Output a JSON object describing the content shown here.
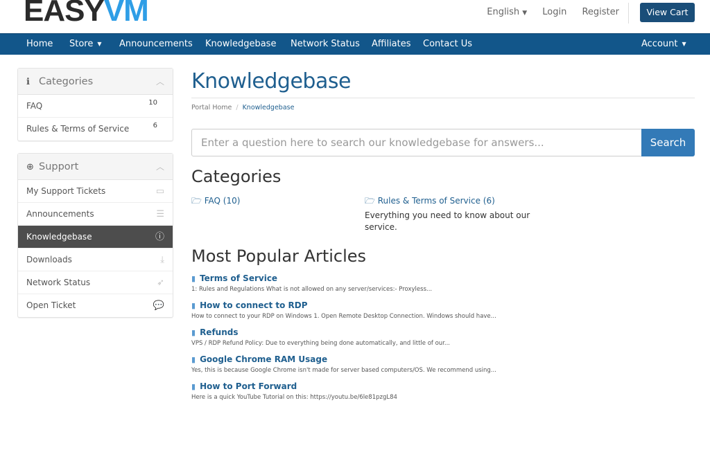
{
  "header": {
    "logo_part1": "EASY",
    "logo_part2": "VM",
    "language": "English",
    "login": "Login",
    "register": "Register",
    "view_cart": "View Cart"
  },
  "nav": {
    "home": "Home",
    "store": "Store",
    "announcements": "Announcements",
    "knowledgebase": "Knowledgebase",
    "network_status": "Network Status",
    "affiliates": "Affiliates",
    "contact_us": "Contact Us",
    "account": "Account"
  },
  "sidebar": {
    "categories_panel": {
      "title": "Categories",
      "items": [
        {
          "label": "FAQ",
          "count": "10"
        },
        {
          "label": "Rules & Terms of Service",
          "count": "6"
        }
      ]
    },
    "support_panel": {
      "title": "Support",
      "items": [
        {
          "label": "My Support Tickets",
          "icon": "ticket-icon"
        },
        {
          "label": "Announcements",
          "icon": "list-icon"
        },
        {
          "label": "Knowledgebase",
          "icon": "info-icon",
          "active": true
        },
        {
          "label": "Downloads",
          "icon": "download-icon"
        },
        {
          "label": "Network Status",
          "icon": "rocket-icon"
        },
        {
          "label": "Open Ticket",
          "icon": "comments-icon"
        }
      ]
    }
  },
  "main": {
    "title": "Knowledgebase",
    "breadcrumb": {
      "home": "Portal Home",
      "current": "Knowledgebase"
    },
    "search": {
      "placeholder": "Enter a question here to search our knowledgebase for answers...",
      "button": "Search"
    },
    "categories_heading": "Categories",
    "categories": [
      {
        "name": "FAQ (10)",
        "description": ""
      },
      {
        "name": "Rules & Terms of Service (6)",
        "description": "Everything you need to know about our service."
      }
    ],
    "popular_heading": "Most Popular Articles",
    "articles": [
      {
        "title": "Terms of Service",
        "excerpt": "1: Rules and Regulations What is not allowed on any server/services:- Proxyless..."
      },
      {
        "title": "How to connect to RDP",
        "excerpt": "How to connect to your RDP on Windows 1. Open Remote Desktop Connection. Windows should have..."
      },
      {
        "title": "Refunds",
        "excerpt": "VPS / RDP Refund Policy: Due to everything being done automatically, and little of our..."
      },
      {
        "title": "Google Chrome RAM Usage",
        "excerpt": "Yes, this is because Google Chrome isn't made for server based computers/OS. We recommend using..."
      },
      {
        "title": "How to Port Forward",
        "excerpt": "Here is a quick YouTube Tutorial on this: https://youtu.be/6le81pzgL84"
      }
    ]
  },
  "colors": {
    "navbar": "#12568a",
    "view_cart": "#1a4e79",
    "primary_link": "#1f5f8f",
    "search_button": "#337ab7",
    "active_item": "#4d4d4d",
    "logo_accent": "#2f9ee6"
  }
}
